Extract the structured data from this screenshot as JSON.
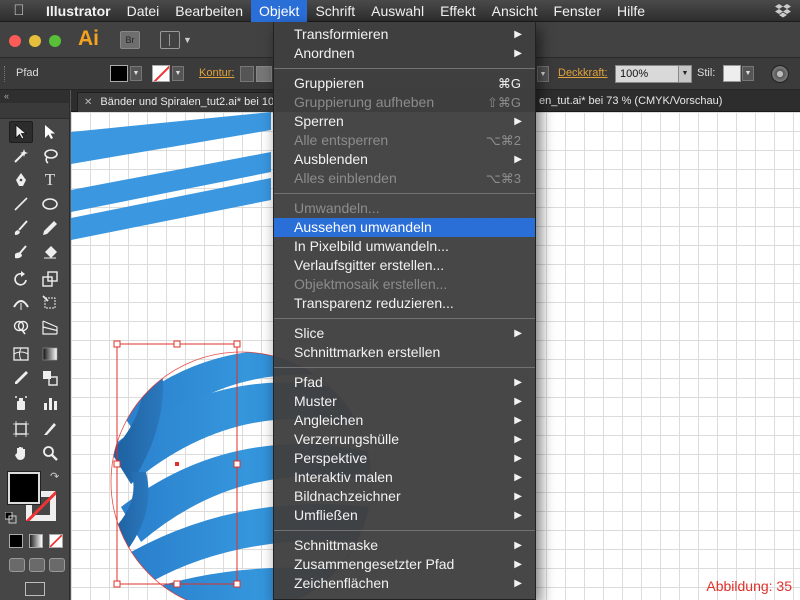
{
  "menubar": {
    "app_name": "Illustrator",
    "items": [
      "Datei",
      "Bearbeiten",
      "Objekt",
      "Schrift",
      "Auswahl",
      "Effekt",
      "Ansicht",
      "Fenster",
      "Hilfe"
    ],
    "active": "Objekt"
  },
  "appbar": {
    "logo": "Ai",
    "bridge": "Br"
  },
  "controlbar": {
    "object_type": "Pfad",
    "kontur_label": "Kontur:",
    "deckkraft_label": "Deckkraft:",
    "opacity_value": "100%",
    "stil_label": "Stil:"
  },
  "document": {
    "tab_title": "Bänder und Spiralen_tut2.ai* bei 10",
    "tab_title_right": "en_tut.ai* bei 73 % (CMYK/Vorschau)"
  },
  "canvas": {
    "figure_label": "Abbildung: 35"
  },
  "objekt_menu": {
    "groups": [
      [
        {
          "label": "Transformieren",
          "submenu": true
        },
        {
          "label": "Anordnen",
          "submenu": true
        }
      ],
      [
        {
          "label": "Gruppieren",
          "shortcut": "⌘G"
        },
        {
          "label": "Gruppierung aufheben",
          "shortcut": "⇧⌘G",
          "disabled": true
        },
        {
          "label": "Sperren",
          "submenu": true
        },
        {
          "label": "Alle entsperren",
          "shortcut": "⌥⌘2",
          "disabled": true
        },
        {
          "label": "Ausblenden",
          "submenu": true
        },
        {
          "label": "Alles einblenden",
          "shortcut": "⌥⌘3",
          "disabled": true
        }
      ],
      [
        {
          "label": "Umwandeln...",
          "disabled": true
        },
        {
          "label": "Aussehen umwandeln",
          "highlighted": true
        },
        {
          "label": "In Pixelbild umwandeln..."
        },
        {
          "label": "Verlaufsgitter erstellen..."
        },
        {
          "label": "Objektmosaik erstellen...",
          "disabled": true
        },
        {
          "label": "Transparenz reduzieren..."
        }
      ],
      [
        {
          "label": "Slice",
          "submenu": true
        },
        {
          "label": "Schnittmarken erstellen"
        }
      ],
      [
        {
          "label": "Pfad",
          "submenu": true
        },
        {
          "label": "Muster",
          "submenu": true
        },
        {
          "label": "Angleichen",
          "submenu": true
        },
        {
          "label": "Verzerrungshülle",
          "submenu": true
        },
        {
          "label": "Perspektive",
          "submenu": true
        },
        {
          "label": "Interaktiv malen",
          "submenu": true
        },
        {
          "label": "Bildnachzeichner",
          "submenu": true
        },
        {
          "label": "Umfließen",
          "submenu": true
        }
      ],
      [
        {
          "label": "Schnittmaske",
          "submenu": true
        },
        {
          "label": "Zusammengesetzter Pfad",
          "submenu": true
        },
        {
          "label": "Zeichenflächen",
          "submenu": true
        }
      ]
    ]
  },
  "colors": {
    "accent": "#2a6ed8",
    "artwork_blue": "#2f8ed8",
    "selection_red": "#e0302a"
  },
  "icons": [
    "apple-icon",
    "dropbox-icon",
    "close-icon",
    "submenu-arrow-icon",
    "selection-tool-icon",
    "direct-selection-tool-icon",
    "magic-wand-icon",
    "lasso-icon",
    "pen-icon",
    "type-icon",
    "line-icon",
    "ellipse-icon",
    "brush-icon",
    "pencil-icon",
    "blob-brush-icon",
    "eraser-icon",
    "rotate-icon",
    "scale-icon",
    "width-icon",
    "free-transform-icon",
    "shape-builder-icon",
    "perspective-grid-icon",
    "mesh-icon",
    "gradient-icon",
    "eyedropper-icon",
    "blend-icon",
    "symbol-sprayer-icon",
    "graph-icon",
    "artboard-icon",
    "slice-icon",
    "hand-icon",
    "zoom-icon"
  ]
}
